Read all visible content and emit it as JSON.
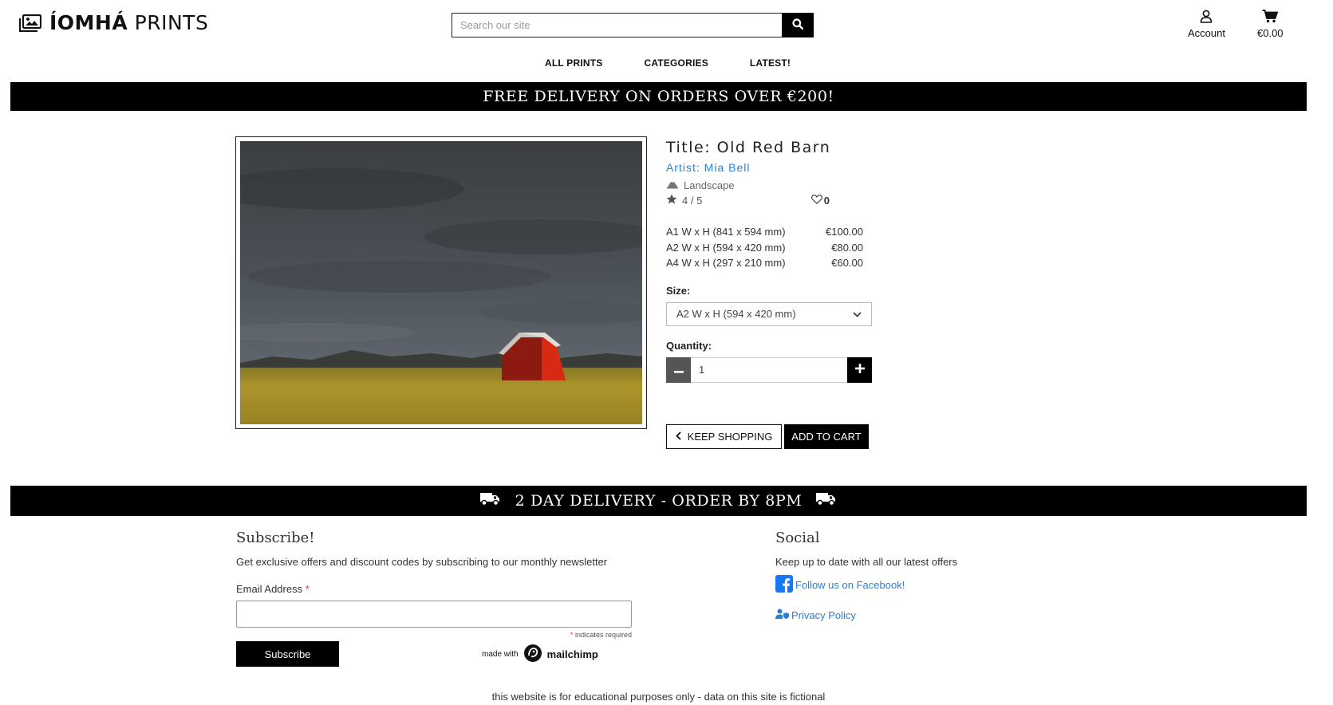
{
  "header": {
    "logo_bold": "ÍOMHÁ",
    "logo_light": "PRINTS",
    "search_placeholder": "Search our site",
    "account_label": "Account",
    "cart_total": "€0.00"
  },
  "nav": {
    "items": [
      "ALL PRINTS",
      "CATEGORIES",
      "LATEST!"
    ]
  },
  "banner_top": "FREE DELIVERY ON ORDERS OVER €200!",
  "product": {
    "title": "Title: Old Red Barn",
    "artist": "Artist: Mia Bell",
    "category": "Landscape",
    "rating": "4 / 5",
    "likes": "0",
    "prices": [
      {
        "size": "A1 W x H (841 x 594 mm)",
        "price": "€100.00"
      },
      {
        "size": "A2 W x H (594 x 420 mm)",
        "price": "€80.00"
      },
      {
        "size": "A4 W x H (297 x 210 mm)",
        "price": "€60.00"
      }
    ],
    "size_label": "Size:",
    "size_selected": "A2 W x H (594 x 420 mm)",
    "quantity_label": "Quantity:",
    "quantity_value": "1",
    "keep_shopping": "KEEP SHOPPING",
    "add_to_cart": "ADD TO CART"
  },
  "banner_bottom": "2 DAY DELIVERY - ORDER BY 8PM",
  "footer": {
    "subscribe_heading": "Subscribe!",
    "subscribe_text": "Get exclusive offers and discount codes by subscribing to our monthly newsletter",
    "email_label": "Email Address",
    "required_mark": "*",
    "required_note": "indicates required",
    "subscribe_button": "Subscribe",
    "made_with": "made with",
    "mailchimp": "mailchimp",
    "social_heading": "Social",
    "social_text": "Keep up to date with all our latest offers",
    "facebook_link": "Follow us on Facebook!",
    "privacy_link": "Privacy Policy",
    "disclaimer": "this website is for educational purposes only - data on this site is fictional"
  },
  "colors": {
    "link": "#2a7fd4",
    "banner_bg": "#000000",
    "facebook": "#1877f2",
    "required": "#dd3333"
  },
  "icons": [
    "image-icon",
    "search-icon",
    "user-icon",
    "cart-icon",
    "mountain-icon",
    "star-icon",
    "heart-icon",
    "chevron-down-icon",
    "minus-icon",
    "plus-icon",
    "chevron-left-icon",
    "truck-icon",
    "facebook-icon",
    "user-shield-icon",
    "mailchimp-icon"
  ]
}
